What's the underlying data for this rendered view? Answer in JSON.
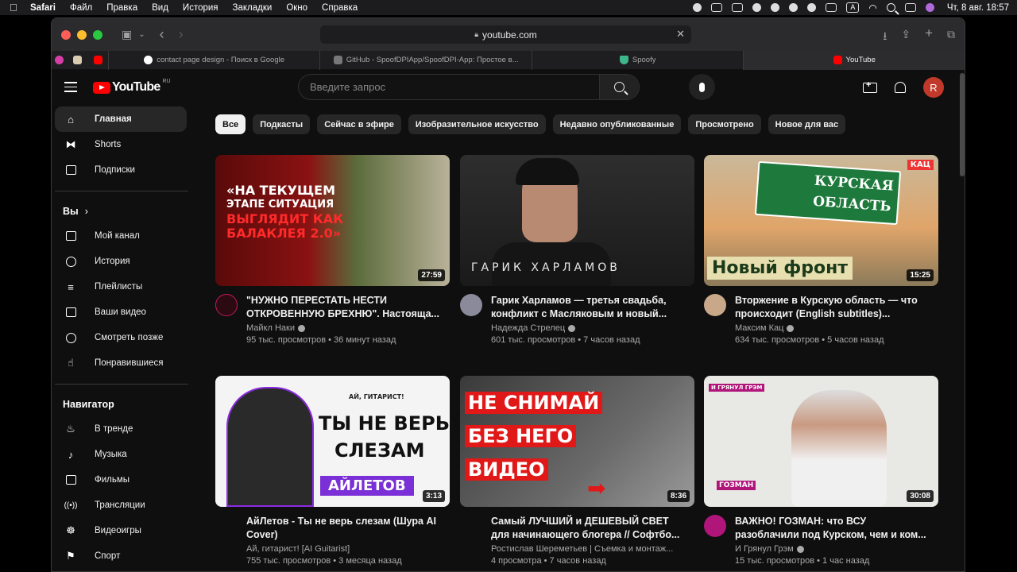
{
  "menubar": {
    "app": "Safari",
    "items": [
      "Файл",
      "Правка",
      "Вид",
      "История",
      "Закладки",
      "Окно",
      "Справка"
    ],
    "clock": "Чт, 8 авг.  18:57",
    "input_badge": "A"
  },
  "browser": {
    "url": "youtube.com",
    "tabs": [
      {
        "label": "",
        "color": "#d63fa8"
      },
      {
        "label": "",
        "color": "#d9cbb0"
      },
      {
        "label": "",
        "color": "#ff0000"
      },
      {
        "label": "contact page design - Поиск в Google",
        "color": "#ffffff"
      },
      {
        "label": "GitHub - SpoofDPIApp/SpoofDPI-App: Простое в...",
        "color": "#777777"
      },
      {
        "label": "Spoofy",
        "color": "#3fb58c"
      },
      {
        "label": "YouTube",
        "color": "#ff0000"
      }
    ]
  },
  "youtube": {
    "logo_text": "YouTube",
    "region": "RU",
    "search_placeholder": "Введите запрос",
    "avatar_letter": "R",
    "sidebar": {
      "main": [
        {
          "label": "Главная",
          "icon": "home-icon"
        },
        {
          "label": "Shorts",
          "icon": "shorts-icon"
        },
        {
          "label": "Подписки",
          "icon": "subscriptions-icon"
        }
      ],
      "you_heading": "Вы",
      "you": [
        {
          "label": "Мой канал",
          "icon": "channel-icon"
        },
        {
          "label": "История",
          "icon": "history-icon"
        },
        {
          "label": "Плейлисты",
          "icon": "playlists-icon"
        },
        {
          "label": "Ваши видео",
          "icon": "your-videos-icon"
        },
        {
          "label": "Смотреть позже",
          "icon": "watch-later-icon"
        },
        {
          "label": "Понравившиеся",
          "icon": "liked-icon"
        }
      ],
      "nav_heading": "Навигатор",
      "nav": [
        {
          "label": "В тренде",
          "icon": "trending-icon"
        },
        {
          "label": "Музыка",
          "icon": "music-icon"
        },
        {
          "label": "Фильмы",
          "icon": "movies-icon"
        },
        {
          "label": "Трансляции",
          "icon": "live-icon"
        },
        {
          "label": "Видеоигры",
          "icon": "gaming-icon"
        },
        {
          "label": "Спорт",
          "icon": "sports-icon"
        }
      ]
    },
    "chips": [
      "Все",
      "Подкасты",
      "Сейчас в эфире",
      "Изобразительное искусство",
      "Недавно опубликованные",
      "Просмотрено",
      "Новое для вас"
    ],
    "videos": [
      {
        "title": "\"НУЖНО ПЕРЕСТАТЬ НЕСТИ ОТКРОВЕННУЮ БРЕХНЮ\". Настояща...",
        "channel": "Майкл Наки",
        "stats": "95 тыс. просмотров • 36 минут назад",
        "duration": "27:59",
        "thumb_lines": [
          "«НА ТЕКУЩЕМ",
          "ЭТАПЕ СИТУАЦИЯ",
          "ВЫГЛЯДИТ КАК",
          "БАЛАКЛЕЯ 2.0»"
        ]
      },
      {
        "title": "Гарик Харламов — третья свадьба, конфликт с Масляковым и новый...",
        "channel": "Надежда Стрелец",
        "stats": "601 тыс. просмотров • 7 часов назад",
        "duration": "",
        "thumb_lines": [
          "ГАРИК ХАРЛАМОВ"
        ]
      },
      {
        "title": "Вторжение в Курскую область — что происходит (English subtitles)...",
        "channel": "Максим Кац",
        "stats": "634 тыс. просмотров • 5 часов назад",
        "duration": "15:25",
        "thumb_lines": [
          "КУРСКАЯ",
          "ОБЛАСТЬ",
          "Новый фронт",
          "КАЦ"
        ]
      },
      {
        "title": "АйЛетов - Ты не верь слезам (Шура AI Cover)",
        "channel": "Ай, гитарист! [AI Guitarist]",
        "stats": "755 тыс. просмотров • 3 месяца назад",
        "duration": "3:13",
        "thumb_lines": [
          "ТЫ НЕ ВЕРЬ",
          "СЛЕЗАМ",
          "АЙЛЕТОВ",
          "АЙ, ГИТАРИСТ!"
        ]
      },
      {
        "title": "Самый ЛУЧШИЙ и ДЕШЕВЫЙ СВЕТ для начинающего блогера // Софтбо...",
        "channel": "Ростислав Шереметьев | Съемка и монтаж...",
        "stats": "4 просмотра • 7 часов назад",
        "duration": "8:36",
        "thumb_lines": [
          "НЕ СНИМАЙ",
          "БЕЗ НЕГО",
          "ВИДЕО"
        ]
      },
      {
        "title": "ВАЖНО! ГОЗМАН: что ВСУ разоблачили под Курском, чем и ком...",
        "channel": "И Грянул Грэм",
        "stats": "15 тыс. просмотров • 1 час назад",
        "duration": "30:08",
        "thumb_lines": [
          "И ГРЯНУЛ ГРЭМ",
          "ГОЗМАН"
        ]
      }
    ]
  }
}
